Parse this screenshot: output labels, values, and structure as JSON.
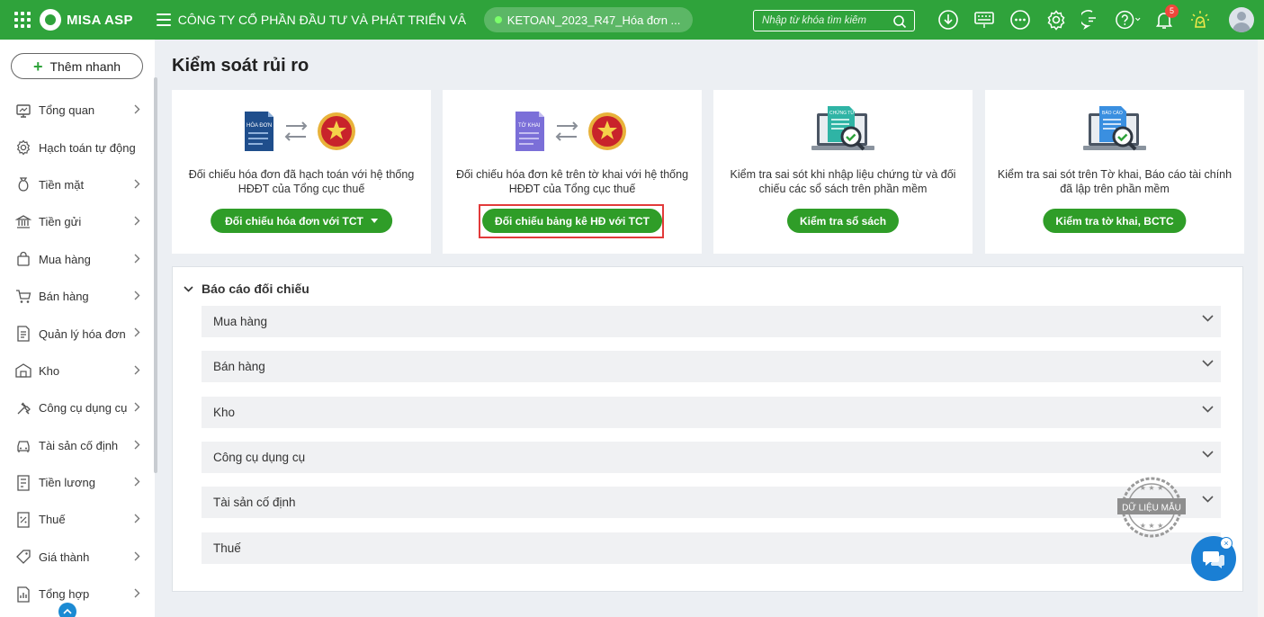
{
  "topbar": {
    "logo_text": "MISA ASP",
    "company": "CÔNG TY CỔ PHẦN ĐẦU TƯ VÀ PHÁT TRIỂN VÂN P...",
    "database": "KETOAN_2023_R47_Hóa đơn ...",
    "search_placeholder": "Nhập từ khóa tìm kiếm",
    "notification_count": "5",
    "accent": "#2fa33b"
  },
  "sidebar": {
    "quick_add": "Thêm nhanh",
    "items": [
      {
        "label": "Tổng quan",
        "icon": "monitor-icon",
        "chevron": true
      },
      {
        "label": "Hạch toán tự động",
        "icon": "gear-icon",
        "chevron": false
      },
      {
        "label": "Tiền mặt",
        "icon": "money-bag-icon",
        "chevron": true
      },
      {
        "label": "Tiền gửi",
        "icon": "bank-icon",
        "chevron": true
      },
      {
        "label": "Mua hàng",
        "icon": "shopping-bag-icon",
        "chevron": true
      },
      {
        "label": "Bán hàng",
        "icon": "cart-icon",
        "chevron": true
      },
      {
        "label": "Quản lý hóa đơn",
        "icon": "invoice-icon",
        "chevron": true
      },
      {
        "label": "Kho",
        "icon": "warehouse-icon",
        "chevron": true
      },
      {
        "label": "Công cụ dụng cụ",
        "icon": "tools-icon",
        "chevron": true
      },
      {
        "label": "Tài sản cố định",
        "icon": "car-icon",
        "chevron": true
      },
      {
        "label": "Tiền lương",
        "icon": "payroll-icon",
        "chevron": true
      },
      {
        "label": "Thuế",
        "icon": "tax-icon",
        "chevron": true
      },
      {
        "label": "Giá thành",
        "icon": "price-tag-icon",
        "chevron": true
      },
      {
        "label": "Tổng hợp",
        "icon": "summary-icon",
        "chevron": true
      }
    ]
  },
  "main": {
    "title": "Kiểm soát rủi ro",
    "cards": [
      {
        "doc_label": "HÓA ĐƠN",
        "desc": "Đối chiếu hóa đơn đã hạch toán với hệ thống HĐĐT của Tổng cục thuế",
        "button": "Đối chiếu hóa đơn với TCT"
      },
      {
        "doc_label": "TỜ KHAI",
        "desc": "Đối chiếu hóa đơn kê trên tờ khai với hệ thống HĐĐT của Tổng cục thuế",
        "button": "Đối chiếu bảng kê HĐ với TCT"
      },
      {
        "doc_label": "CHỨNG TỪ",
        "desc": "Kiểm tra sai sót khi nhập liệu chứng từ và đối chiếu các sổ sách trên phần mềm",
        "button": "Kiểm tra sổ sách"
      },
      {
        "doc_label": "BÁO CÁO",
        "desc": "Kiểm tra sai sót trên Tờ khai, Báo cáo tài chính đã lập trên phần mềm",
        "button": "Kiểm tra tờ khai, BCTC"
      }
    ],
    "report": {
      "title": "Báo cáo đối chiếu",
      "items": [
        "Mua hàng",
        "Bán hàng",
        "Kho",
        "Công cụ dụng cụ",
        "Tài sản cố định",
        "Thuế"
      ]
    },
    "stamp_text": "DỮ LIỆU MẪU"
  }
}
